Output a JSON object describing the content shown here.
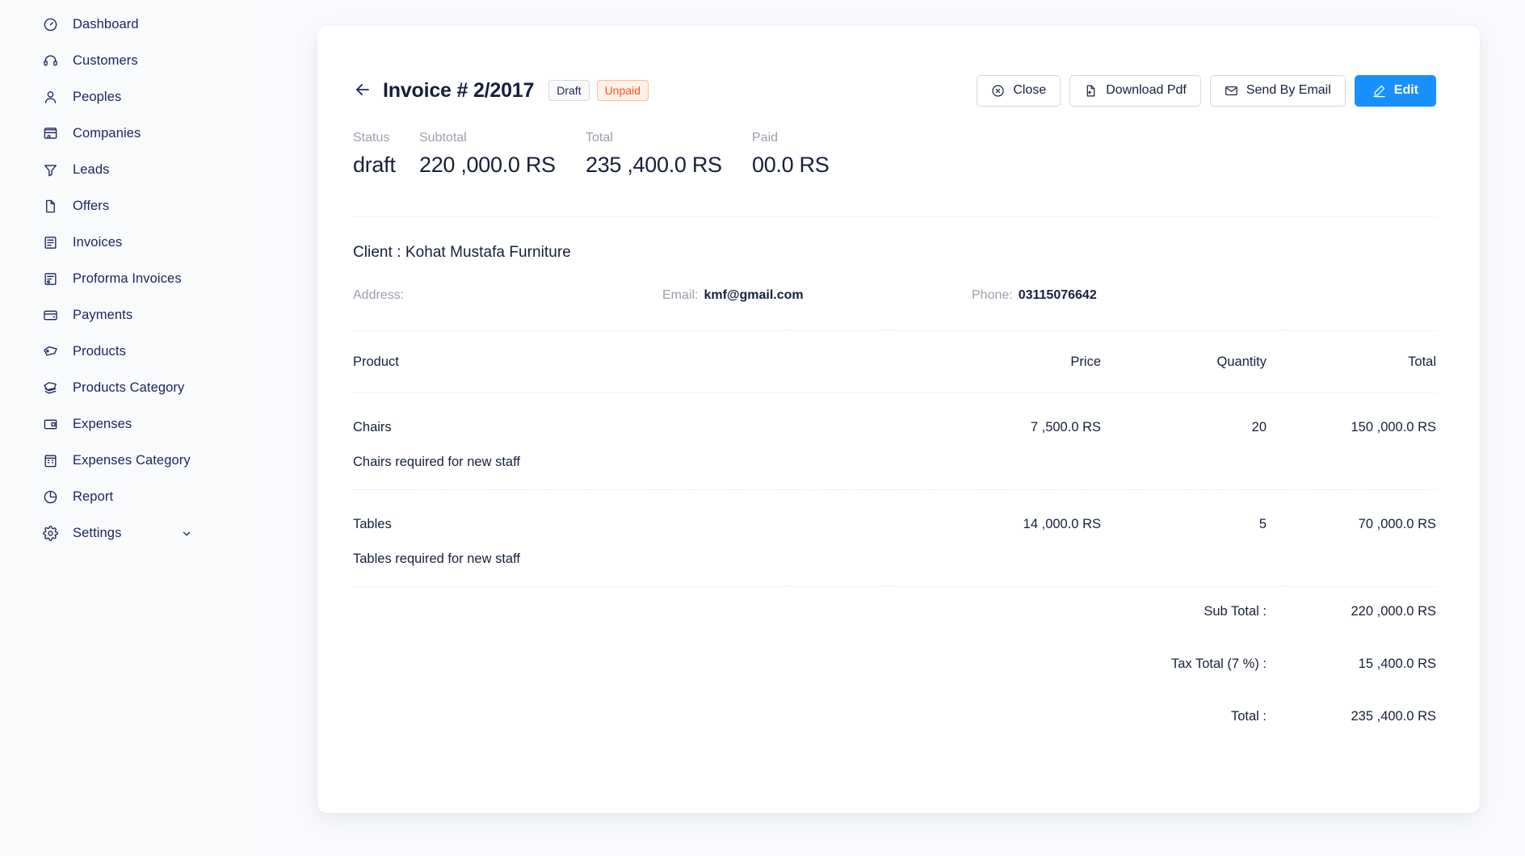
{
  "sidebar": {
    "items": [
      {
        "label": "Dashboard",
        "icon": "dashboard-icon"
      },
      {
        "label": "Customers",
        "icon": "headset-icon"
      },
      {
        "label": "Peoples",
        "icon": "user-icon"
      },
      {
        "label": "Companies",
        "icon": "building-icon"
      },
      {
        "label": "Leads",
        "icon": "funnel-icon"
      },
      {
        "label": "Offers",
        "icon": "file-icon"
      },
      {
        "label": "Invoices",
        "icon": "invoice-icon"
      },
      {
        "label": "Proforma Invoices",
        "icon": "proforma-icon"
      },
      {
        "label": "Payments",
        "icon": "credit-card-icon"
      },
      {
        "label": "Products",
        "icon": "tag-icon"
      },
      {
        "label": "Products Category",
        "icon": "tags-icon"
      },
      {
        "label": "Expenses",
        "icon": "wallet-icon"
      },
      {
        "label": "Expenses Category",
        "icon": "expense-category-icon"
      },
      {
        "label": "Report",
        "icon": "pie-chart-icon"
      },
      {
        "label": "Settings",
        "icon": "gear-icon",
        "caret": "chevron-down-icon"
      }
    ]
  },
  "invoice": {
    "title": "Invoice # 2/2017",
    "badges": {
      "status": "Draft",
      "payment": "Unpaid"
    },
    "actions": {
      "close": "Close",
      "download": "Download Pdf",
      "email": "Send By Email",
      "edit": "Edit"
    },
    "stats": [
      {
        "label": "Status",
        "value": "draft"
      },
      {
        "label": "Subtotal",
        "value": "220 ,000.0 RS"
      },
      {
        "label": "Total",
        "value": "235 ,400.0 RS"
      },
      {
        "label": "Paid",
        "value": "00.0 RS"
      }
    ],
    "client": {
      "heading": "Client : Kohat Mustafa Furniture",
      "address_label": "Address:",
      "address_value": "",
      "email_label": "Email:",
      "email_value": "kmf@gmail.com",
      "phone_label": "Phone:",
      "phone_value": "03115076642"
    },
    "table": {
      "headers": {
        "product": "Product",
        "price": "Price",
        "quantity": "Quantity",
        "total": "Total"
      },
      "rows": [
        {
          "product": "Chairs",
          "price": "7 ,500.0 RS",
          "quantity": "20",
          "total": "150 ,000.0 RS",
          "description": "Chairs required for new staff"
        },
        {
          "product": "Tables",
          "price": "14 ,000.0 RS",
          "quantity": "5",
          "total": "70 ,000.0 RS",
          "description": "Tables required for new staff"
        }
      ]
    },
    "totals": [
      {
        "label": "Sub Total :",
        "value": "220 ,000.0 RS"
      },
      {
        "label": "Tax Total (7 %) :",
        "value": "15 ,400.0 RS"
      },
      {
        "label": "Total :",
        "value": "235 ,400.0 RS"
      }
    ]
  },
  "colors": {
    "accent": "#1890ff",
    "unpaid_text": "#fa541c",
    "unpaid_bg": "#fff2e8",
    "unpaid_border": "#ffbb96",
    "page_bg": "#f7f9fc",
    "text": "#16203c",
    "muted": "#9aa0ab"
  }
}
